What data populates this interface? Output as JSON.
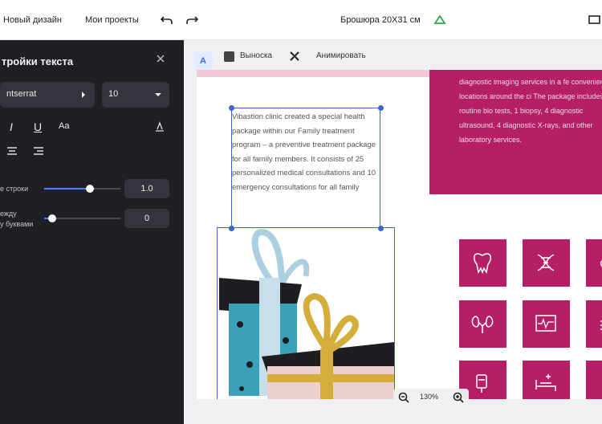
{
  "topbar": {
    "new_design": "Новый дизайн",
    "my_projects": "Мои проекты",
    "doc_title": "Брошюра 20Х31 см"
  },
  "panel": {
    "title": "тройки текста",
    "font_name": "ntserrat",
    "font_size": "10",
    "line_spacing_label": "е строки",
    "line_spacing_value": "1.0",
    "letter_spacing_label_1": "ежду",
    "letter_spacing_label_2": "у буквами",
    "letter_spacing_value": "0",
    "line_spacing_level": 0.6,
    "letter_spacing_level": 0.1
  },
  "toolbar": {
    "text_tool": "A",
    "stroke_label": "Выноска",
    "animate_label": "Анимировать"
  },
  "canvas": {
    "textbox_text": "Vibastion clinic created a special health package within our Family treatment program – a preventive treatment package for all family members. It consists of 25 personalized medical consultations and 10 emergency consultations for all family",
    "magenta_text": "diagnostic imaging services in a fe convenient locations around the ci The package includes 6 routine blo tests, 1 biopsy, 4 diagnostic ultrasound, 4 diagnostic X-rays, and other laboratory services.",
    "zoom": "130%"
  },
  "colors": {
    "accent": "#3f62d6",
    "brand_magenta": "#b41f66",
    "panel_bg": "#1f2026"
  },
  "icons": [
    "undo-icon",
    "redo-icon",
    "cloud-icon",
    "close-icon",
    "tooth-icon",
    "dna-icon",
    "bandage-icon",
    "kidneys-icon",
    "heart-monitor-icon",
    "iv-drip-icon",
    "hospital-bed-icon",
    "zoom-out-icon",
    "zoom-in-icon"
  ]
}
